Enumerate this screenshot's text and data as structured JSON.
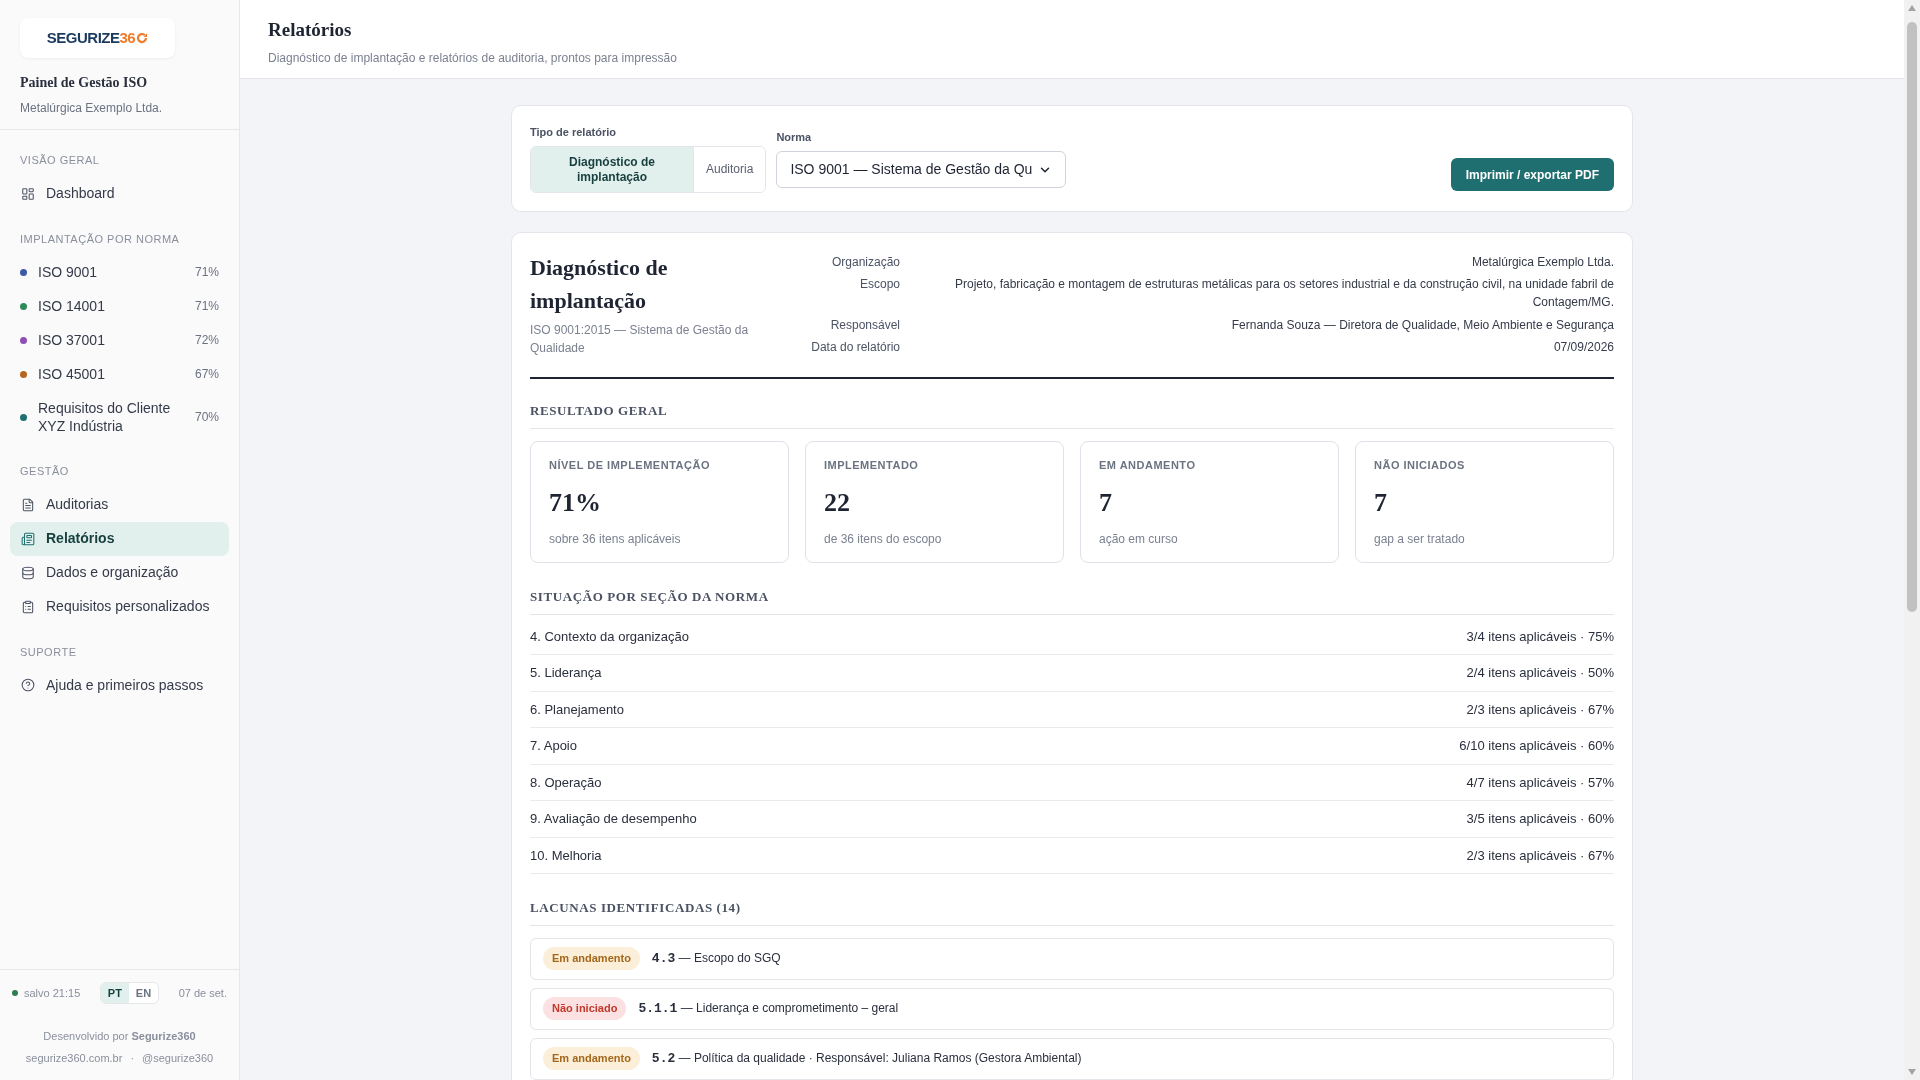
{
  "sidebar": {
    "logo": {
      "text": "SEGURIZE",
      "accent": "36"
    },
    "title": "Painel de Gestão ISO",
    "org": "Metalúrgica Exemplo Ltda.",
    "groups": [
      {
        "title": "VISÃO GERAL",
        "items": [
          {
            "kind": "nav",
            "label": "Dashboard",
            "selected": false
          }
        ]
      },
      {
        "title": "IMPLANTAÇÃO POR NORMA",
        "items": [
          {
            "kind": "norm",
            "label": "ISO 9001",
            "percent": "71%",
            "color": "#3b5ba9"
          },
          {
            "kind": "norm",
            "label": "ISO 14001",
            "percent": "71%",
            "color": "#2e8b57"
          },
          {
            "kind": "norm",
            "label": "ISO 37001",
            "percent": "72%",
            "color": "#8e4fb5"
          },
          {
            "kind": "norm",
            "label": "ISO 45001",
            "percent": "67%",
            "color": "#b7651e"
          },
          {
            "kind": "norm",
            "label": "Requisitos do Cliente XYZ Indústria",
            "percent": "70%",
            "color": "#1f6f70"
          }
        ]
      },
      {
        "title": "GESTÃO",
        "items": [
          {
            "kind": "nav",
            "label": "Auditorias",
            "selected": false
          },
          {
            "kind": "nav",
            "label": "Relatórios",
            "selected": true
          },
          {
            "kind": "nav",
            "label": "Dados e organização",
            "selected": false
          },
          {
            "kind": "nav",
            "label": "Requisitos personalizados",
            "selected": false
          }
        ]
      },
      {
        "title": "SUPORTE",
        "items": [
          {
            "kind": "nav",
            "label": "Ajuda e primeiros passos",
            "selected": false
          }
        ]
      }
    ],
    "footer": {
      "saved": {
        "text": "salvo 21:15",
        "color": "#2e7d4f"
      },
      "languages": [
        {
          "label": "PT",
          "selected": true
        },
        {
          "label": "EN",
          "selected": false
        }
      ],
      "date": "07 de set.",
      "credit": "Desenvolvido por **Segurize360**",
      "site": "segurize360.com.br",
      "separator": "·",
      "handle": "@segurize360"
    }
  },
  "header": {
    "title": "Relatórios",
    "subtitle": "Diagnóstico de implantação e relatórios de auditoria, prontos para impressão"
  },
  "controls": {
    "report_type": {
      "label": "Tipo de relatório",
      "options": [
        {
          "label": "Diagnóstico de implantação",
          "selected": true
        },
        {
          "label": "Auditoria",
          "selected": false
        }
      ]
    },
    "norma": {
      "label": "Norma",
      "value": "ISO 9001 — Sistema de Gestão da Qu"
    },
    "export_button": "Imprimir / exportar PDF"
  },
  "report": {
    "title": "Diagnóstico de implantação",
    "subtitle": "ISO 9001:2015 — Sistema de Gestão da Qualidade",
    "meta": [
      {
        "label": "Organização",
        "value": "Metalúrgica Exemplo Ltda."
      },
      {
        "label": "Escopo",
        "value": "Projeto, fabricação e montagem de estruturas metálicas para os setores industrial e da construção civil, na unidade fabril de Contagem/MG."
      },
      {
        "label": "Responsável",
        "value": "Fernanda Souza — Diretora de Qualidade, Meio Ambiente e Segurança"
      },
      {
        "label": "Data do relatório",
        "value": "07/09/2026"
      }
    ],
    "result_title": "RESULTADO GERAL",
    "stats": [
      {
        "label": "NÍVEL DE IMPLEMENTAÇÃO",
        "value": "71%",
        "note": "sobre 36 itens aplicáveis"
      },
      {
        "label": "IMPLEMENTADO",
        "value": "22",
        "note": "de 36 itens do escopo"
      },
      {
        "label": "EM ANDAMENTO",
        "value": "7",
        "note": "ação em curso"
      },
      {
        "label": "NÃO INICIADOS",
        "value": "7",
        "note": "gap a ser tratado"
      }
    ],
    "sections_title": "SITUAÇÃO POR SEÇÃO DA NORMA",
    "sections": [
      {
        "name": "4. Contexto da organização",
        "summary": "3/4 itens aplicáveis · 75%"
      },
      {
        "name": "5. Liderança",
        "summary": "2/4 itens aplicáveis · 50%"
      },
      {
        "name": "6. Planejamento",
        "summary": "2/3 itens aplicáveis · 67%"
      },
      {
        "name": "7. Apoio",
        "summary": "6/10 itens aplicáveis · 60%"
      },
      {
        "name": "8. Operação",
        "summary": "4/7 itens aplicáveis · 57%"
      },
      {
        "name": "9. Avaliação de desempenho",
        "summary": "3/5 itens aplicáveis · 60%"
      },
      {
        "name": "10. Melhoria",
        "summary": "2/3 itens aplicáveis · 67%"
      }
    ],
    "gaps_title": "LACUNAS IDENTIFICADAS (14)",
    "gaps": [
      {
        "kind": "in_progress",
        "badge": "Em andamento",
        "code": "4.3",
        "text": "— Escopo do SGQ"
      },
      {
        "kind": "not_started",
        "badge": "Não iniciado",
        "code": "5.1.1",
        "text": "— Liderança e comprometimento – geral"
      },
      {
        "kind": "in_progress",
        "badge": "Em andamento",
        "code": "5.2",
        "text": "— Política da qualidade · Responsável: Juliana Ramos (Gestora Ambiental)"
      }
    ]
  }
}
